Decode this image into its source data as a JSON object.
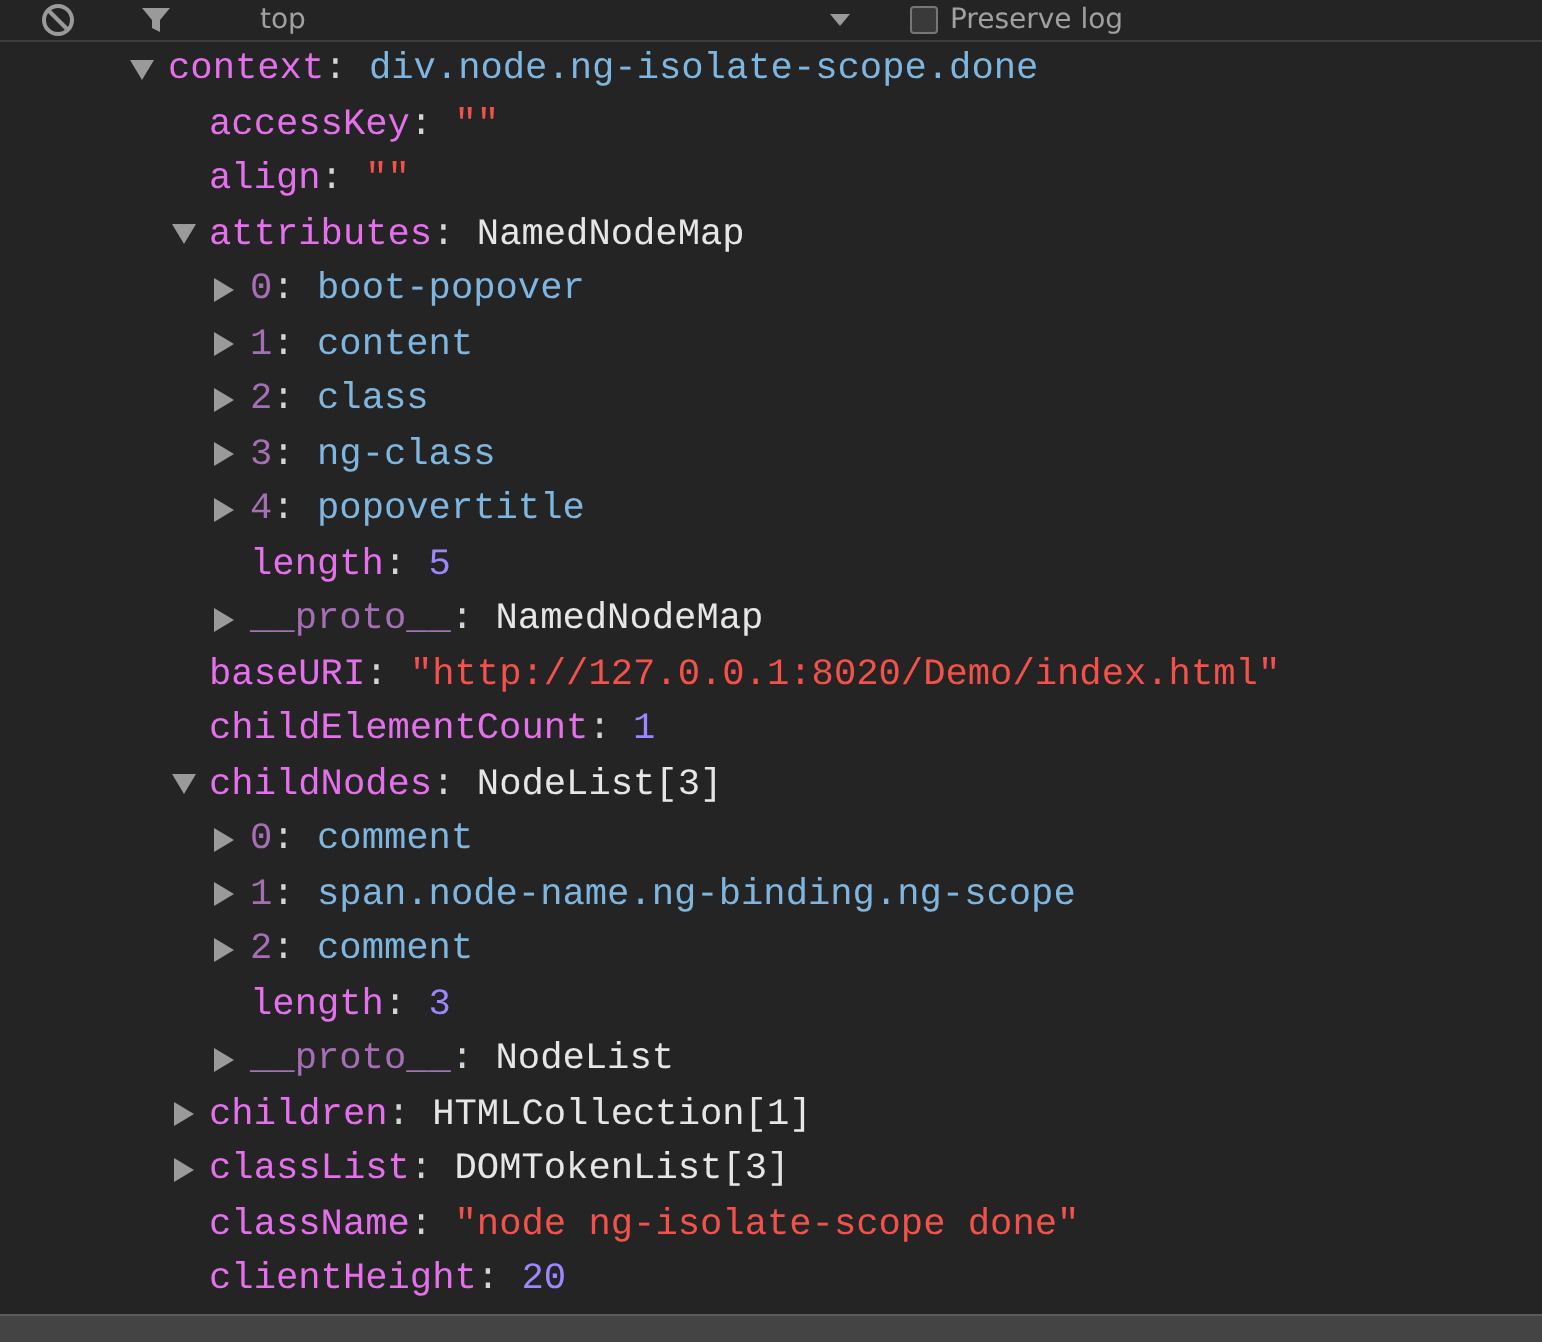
{
  "toolbar": {
    "context": "top",
    "preserve_log": {
      "label": "Preserve log",
      "checked": false
    }
  },
  "tree": [
    {
      "key": "context",
      "sep": ":",
      "kind": "node",
      "value": "div.node.ng-isolate-scope.done",
      "expanded": true,
      "dim_key": false,
      "children": [
        {
          "key": "accessKey",
          "sep": ":",
          "kind": "string",
          "value": "\"\"",
          "dim_key": false
        },
        {
          "key": "align",
          "sep": ":",
          "kind": "string",
          "value": "\"\"",
          "dim_key": false
        },
        {
          "key": "attributes",
          "sep": ":",
          "kind": "object",
          "value": "NamedNodeMap",
          "expanded": true,
          "dim_key": false,
          "children": [
            {
              "key": "0",
              "sep": ":",
              "kind": "node",
              "value": "boot-popover",
              "expanded": false,
              "dim_key": true
            },
            {
              "key": "1",
              "sep": ":",
              "kind": "node",
              "value": "content",
              "expanded": false,
              "dim_key": true
            },
            {
              "key": "2",
              "sep": ":",
              "kind": "node",
              "value": "class",
              "expanded": false,
              "dim_key": true
            },
            {
              "key": "3",
              "sep": ":",
              "kind": "node",
              "value": "ng-class",
              "expanded": false,
              "dim_key": true
            },
            {
              "key": "4",
              "sep": ":",
              "kind": "node",
              "value": "popovertitle",
              "expanded": false,
              "dim_key": true
            },
            {
              "key": "length",
              "sep": ":",
              "kind": "number",
              "value": "5",
              "dim_key": false
            },
            {
              "key": "__proto__",
              "sep": ":",
              "kind": "object",
              "value": "NamedNodeMap",
              "expanded": false,
              "dim_key": true
            }
          ]
        },
        {
          "key": "baseURI",
          "sep": ":",
          "kind": "string",
          "value": "\"http://127.0.0.1:8020/Demo/index.html\"",
          "dim_key": false
        },
        {
          "key": "childElementCount",
          "sep": ":",
          "kind": "number",
          "value": "1",
          "dim_key": false
        },
        {
          "key": "childNodes",
          "sep": ":",
          "kind": "object",
          "value": "NodeList[3]",
          "expanded": true,
          "dim_key": false,
          "children": [
            {
              "key": "0",
              "sep": ":",
              "kind": "node",
              "value": "comment",
              "expanded": false,
              "dim_key": true
            },
            {
              "key": "1",
              "sep": ":",
              "kind": "node",
              "value": "span.node-name.ng-binding.ng-scope",
              "expanded": false,
              "dim_key": true
            },
            {
              "key": "2",
              "sep": ":",
              "kind": "node",
              "value": "comment",
              "expanded": false,
              "dim_key": true
            },
            {
              "key": "length",
              "sep": ":",
              "kind": "number",
              "value": "3",
              "dim_key": false
            },
            {
              "key": "__proto__",
              "sep": ":",
              "kind": "object",
              "value": "NodeList",
              "expanded": false,
              "dim_key": true
            }
          ]
        },
        {
          "key": "children",
          "sep": ":",
          "kind": "object",
          "value": "HTMLCollection[1]",
          "expanded": false,
          "dim_key": false
        },
        {
          "key": "classList",
          "sep": ":",
          "kind": "object",
          "value": "DOMTokenList[3]",
          "expanded": false,
          "dim_key": false
        },
        {
          "key": "className",
          "sep": ":",
          "kind": "string",
          "value": "\"node ng-isolate-scope done\"",
          "dim_key": false
        },
        {
          "key": "clientHeight",
          "sep": ":",
          "kind": "number",
          "value": "20",
          "dim_key": false
        }
      ]
    }
  ]
}
